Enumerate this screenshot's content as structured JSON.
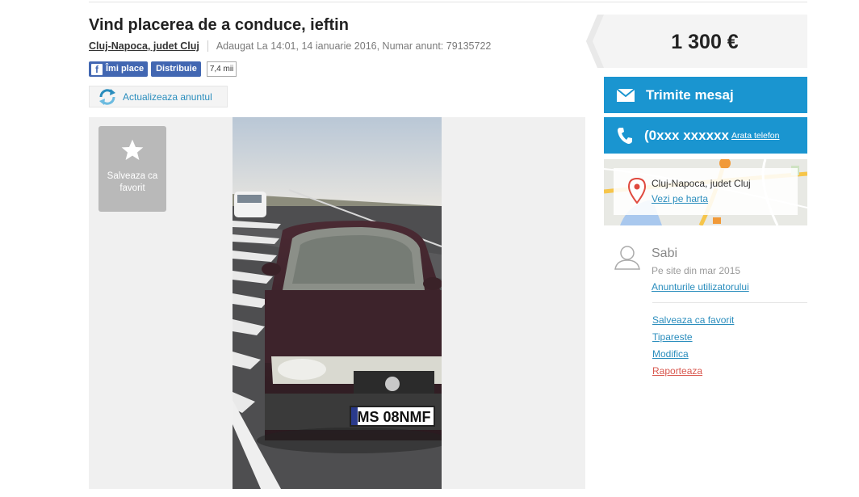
{
  "ad": {
    "title": "Vind placerea de a conduce, ieftin",
    "location": "Cluj-Napoca, judet Cluj",
    "info": "Adaugat La 14:01, 14 ianuarie 2016, Numar anunt: 79135722"
  },
  "social": {
    "like_label": "Îmi place",
    "share_label": "Distribuie",
    "count": "7,4 mii"
  },
  "refresh_label": "Actualizeaza anuntul",
  "gallery": {
    "favorite_label": "Salveaza ca favorit",
    "plate": "MS 08NMF"
  },
  "price": "1 300 €",
  "contact": {
    "message_label": "Trimite mesaj",
    "phone_masked": "(0xxx xxxxxx",
    "show_phone_label": "Arata telefon"
  },
  "map": {
    "location": "Cluj-Napoca, judet Cluj",
    "link_label": "Vezi pe harta"
  },
  "seller": {
    "name": "Sabi",
    "since": "Pe site din mar 2015",
    "ads_link": "Anunturile utilizatorului"
  },
  "actions": {
    "save": "Salveaza ca favorit",
    "print": "Tipareste",
    "edit": "Modifica",
    "report": "Raporteaza"
  },
  "colors": {
    "accent_blue": "#1a95d0",
    "link_blue": "#2a8dbd",
    "facebook_blue": "#4267b2",
    "report_red": "#d9584f"
  }
}
